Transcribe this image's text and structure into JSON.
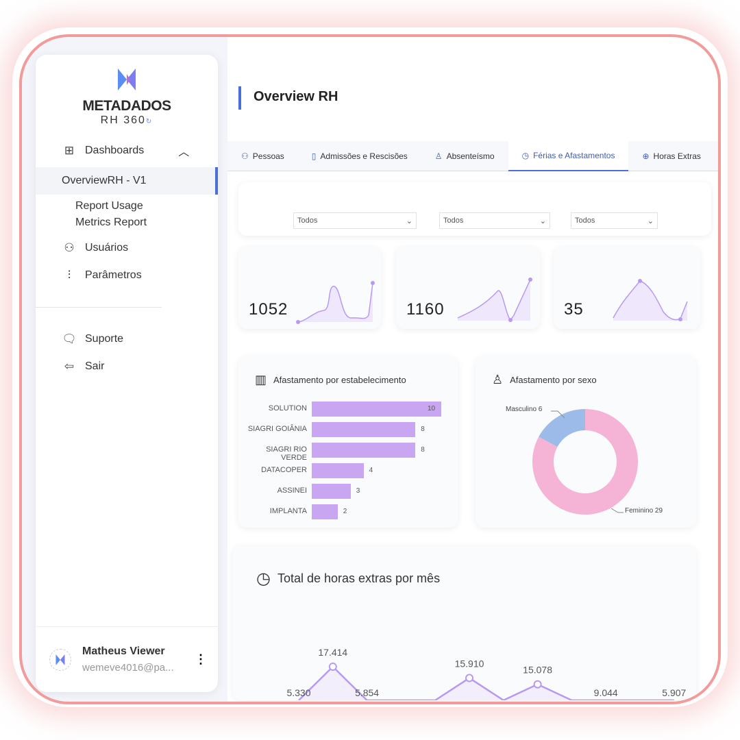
{
  "sidebar": {
    "brand": "METADADOS",
    "product": "RH 360",
    "items": [
      {
        "label": "Dashboards",
        "icon": "grid-icon"
      },
      {
        "label": "OverviewRH - V1"
      },
      {
        "label": "Report Usage Metrics Report"
      },
      {
        "label": "Usuários",
        "icon": "users-icon"
      },
      {
        "label": "Parâmetros",
        "icon": "sliders-icon"
      },
      {
        "label": "Suporte",
        "icon": "chat-icon"
      },
      {
        "label": "Sair",
        "icon": "logout-icon"
      }
    ],
    "user": {
      "name": "Matheus Viewer",
      "email": "wemeve4016@pa..."
    }
  },
  "header": {
    "title": "Overview RH"
  },
  "tabs": [
    {
      "label": "Pessoas",
      "icon": "people-icon"
    },
    {
      "label": "Admissões e Rescisões",
      "icon": "document-icon"
    },
    {
      "label": "Absenteísmo",
      "icon": "person-minus-icon"
    },
    {
      "label": "Férias e Afastamentos",
      "icon": "clock-icon",
      "active": true
    },
    {
      "label": "Horas Extras",
      "icon": "plus-circle-icon"
    }
  ],
  "filters": [
    {
      "value": "Todos"
    },
    {
      "value": "Todos"
    },
    {
      "value": "Todos"
    }
  ],
  "kpis": [
    {
      "value": "1052"
    },
    {
      "value": "1160"
    },
    {
      "value": "35"
    }
  ],
  "accent": "#4a6fd8",
  "chart_data": [
    {
      "type": "bar",
      "title": "Afastamento por estabelecimento",
      "categories": [
        "SOLUTION",
        "SIAGRI GOIÂNIA",
        "SIAGRI RIO VERDE",
        "DATACOPER",
        "ASSINEI",
        "IMPLANTA"
      ],
      "values": [
        10,
        8,
        8,
        4,
        3,
        2
      ],
      "color": "#c8a6f2"
    },
    {
      "type": "pie",
      "title": "Afastamento por sexo",
      "categories": [
        "Masculino",
        "Feminino"
      ],
      "values": [
        6,
        29
      ],
      "labels": [
        "Masculino 6",
        "Feminino 29"
      ],
      "colors": [
        "#9dbbe8",
        "#f5b3d5"
      ]
    },
    {
      "type": "area",
      "title": "Total de horas extras por mês",
      "values": [
        5.33,
        17.414,
        5.854,
        null,
        null,
        15.91,
        null,
        15.078,
        null,
        9.044,
        null,
        5.907
      ],
      "labels": [
        "5.330",
        "17.414",
        "5.854",
        "",
        "",
        "15.910",
        "",
        "15.078",
        "",
        "9.044",
        "",
        "5.907"
      ],
      "color": "#b79af0"
    }
  ]
}
